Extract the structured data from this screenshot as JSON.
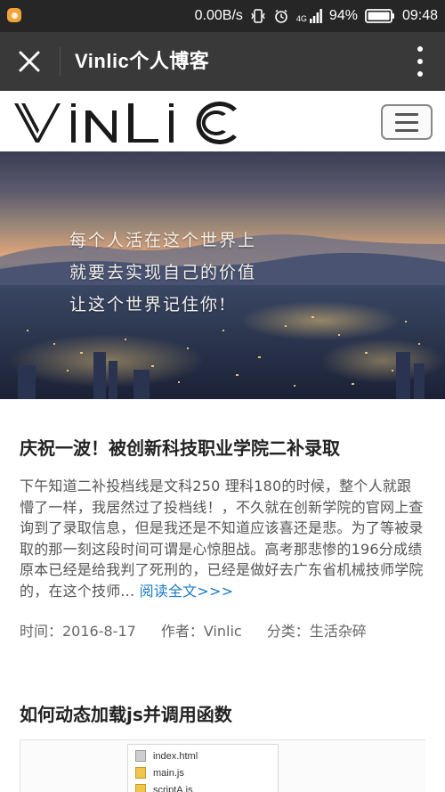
{
  "status_bar": {
    "network_speed": "0.00B/s",
    "network_type": "4G",
    "battery": "94%",
    "time": "09:48",
    "icons": [
      "notification-icon",
      "vibrate-icon",
      "alarm-icon",
      "signal-icon",
      "battery-icon"
    ]
  },
  "app_bar": {
    "title": "Vinlic个人博客",
    "close_icon": "close-icon",
    "more_icon": "more-vertical-icon"
  },
  "site_header": {
    "logo_text": "Vinlic",
    "menu_icon": "hamburger-icon"
  },
  "banner": {
    "lines": [
      "每个人活在这个世界上",
      "就要去实现自己的价值",
      "让这个世界记住你!"
    ]
  },
  "posts": [
    {
      "title": "庆祝一波！被创新科技职业学院二补录取",
      "excerpt": "下午知道二补投档线是文科250 理科180的时候，整个人就跟懵了一样，我居然过了投档线！，不久就在创新学院的官网上查询到了录取信息，但是我还是不知道应该喜还是悲。为了等被录取的那一刻这段时间可谓是心惊胆战。高考那悲惨的196分成绩原本已经是给我判了死刑的，已经是做好去广东省机械技师学院的，在这个技师...",
      "read_more": "阅读全文>>>",
      "meta": {
        "date": "时间：2016-8-17",
        "author": "作者：Vinlic",
        "category": "分类：生活杂碎"
      }
    },
    {
      "title": "如何动态加载js并调用函数",
      "thumbnail_files": [
        "index.html",
        "main.js",
        "scriptA.js"
      ]
    }
  ],
  "colors": {
    "status_bar_bg": "#262626",
    "app_bar_bg": "#393939",
    "link": "#1a7ac8",
    "battery_accent": "#f2a33b"
  }
}
